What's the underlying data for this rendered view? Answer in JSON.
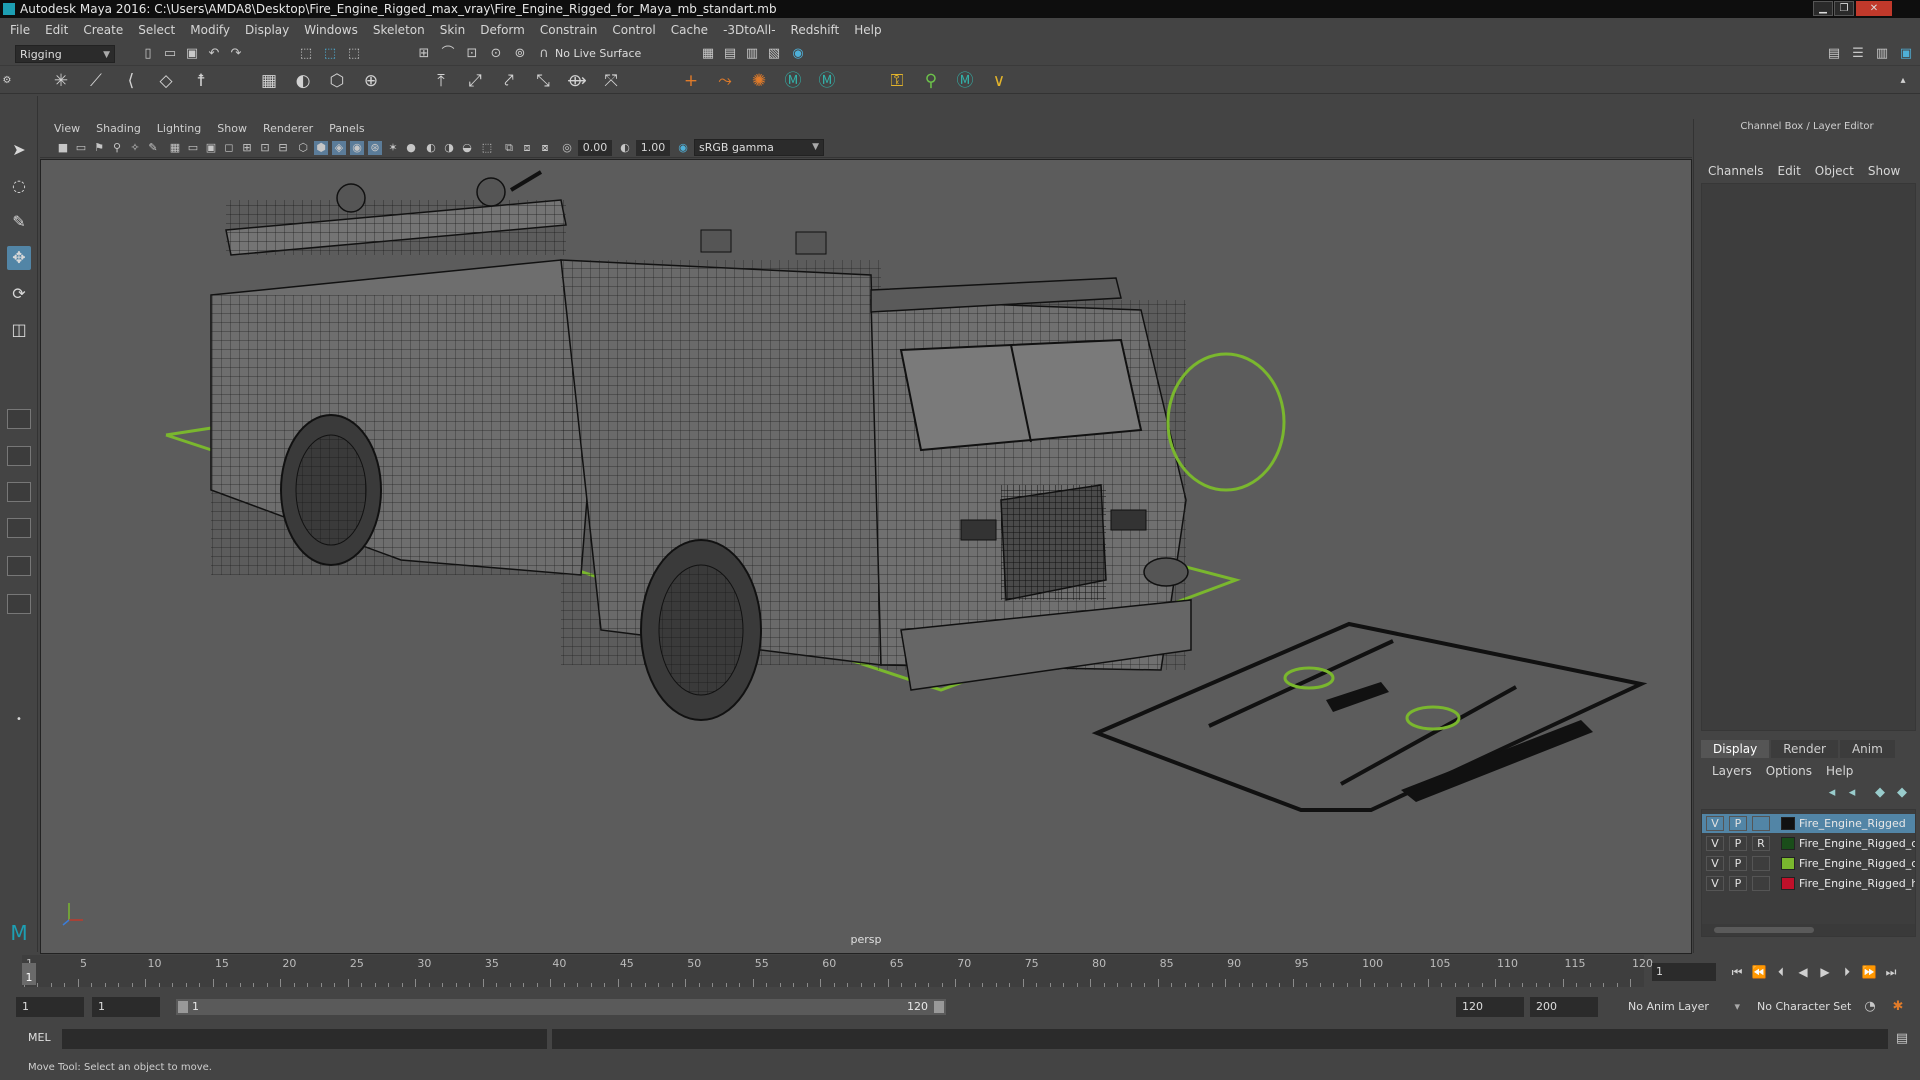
{
  "window": {
    "title": "Autodesk Maya 2016: C:\\Users\\AMDA8\\Desktop\\Fire_Engine_Rigged_max_vray\\Fire_Engine_Rigged_for_Maya_mb_standart.mb",
    "min": "▁",
    "restore": "❐",
    "close": "✕"
  },
  "menubar": [
    "File",
    "Edit",
    "Create",
    "Select",
    "Modify",
    "Display",
    "Windows",
    "Skeleton",
    "Skin",
    "Deform",
    "Constrain",
    "Control",
    "Cache",
    "-3DtoAll-",
    "Redshift",
    "Help"
  ],
  "statusline": {
    "menuset": "Rigging",
    "live_surface": "No Live Surface"
  },
  "viewport": {
    "menus": [
      "View",
      "Shading",
      "Lighting",
      "Show",
      "Renderer",
      "Panels"
    ],
    "exposure": "0.00",
    "gamma": "1.00",
    "colorspace": "sRGB gamma",
    "camera": "persp",
    "colors": {
      "controls": "#7ab72e",
      "background": "#5c5c5c"
    }
  },
  "channelbox": {
    "title": "Channel Box / Layer Editor",
    "menus": [
      "Channels",
      "Edit",
      "Object",
      "Show"
    ],
    "layer_tabs": [
      "Display",
      "Render",
      "Anim"
    ],
    "active_tab": "Display",
    "layer_menus": [
      "Layers",
      "Options",
      "Help"
    ],
    "layers": [
      {
        "v": "V",
        "p": "P",
        "r": "",
        "color": "#111111",
        "name": "Fire_Engine_Rigged",
        "selected": true
      },
      {
        "v": "V",
        "p": "P",
        "r": "R",
        "color": "#1a4d1a",
        "name": "Fire_Engine_Rigged_c",
        "selected": false
      },
      {
        "v": "V",
        "p": "P",
        "r": "",
        "color": "#7ab72e",
        "name": "Fire_Engine_Rigged_c",
        "selected": false
      },
      {
        "v": "V",
        "p": "P",
        "r": "",
        "color": "#c0102a",
        "name": "Fire_Engine_Rigged_h",
        "selected": false
      }
    ]
  },
  "timeslider": {
    "ticks": [
      "1",
      "5",
      "10",
      "15",
      "20",
      "25",
      "30",
      "35",
      "40",
      "45",
      "50",
      "55",
      "60",
      "65",
      "70",
      "75",
      "80",
      "85",
      "90",
      "95",
      "100",
      "105",
      "110",
      "115",
      "120"
    ],
    "current_frame": "1",
    "frame_field": "1"
  },
  "range": {
    "start_field": "1",
    "anim_start": "1",
    "playback_start": "1",
    "playback_end": "120",
    "anim_end_field": "120",
    "end_field": "200",
    "anim_layer": "No Anim Layer",
    "character_set": "No Character Set"
  },
  "cmdline": {
    "lang": "MEL"
  },
  "helpline": "Move Tool: Select an object to move."
}
